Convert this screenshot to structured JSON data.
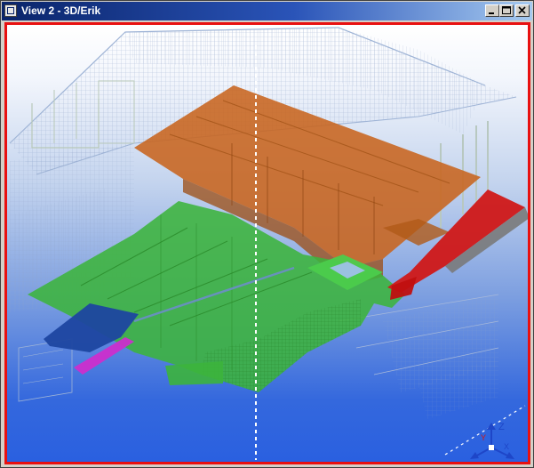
{
  "window": {
    "title": "View 2 - 3D/Erik",
    "icon": "view-icon",
    "buttons": {
      "minimize": "minimize-icon",
      "maximize": "maximize-icon",
      "close": "close-icon"
    }
  },
  "viewport": {
    "frame_color": "#e81010",
    "background_top": "#ffffff",
    "background_bottom": "#2a60e0"
  },
  "model": {
    "colors": {
      "wireframe": "#8ea2c8",
      "roof_slab": "#c8641e",
      "floor_slab": "#3cb43c",
      "blue_slab": "#1e46a0",
      "magenta_beam": "#cc2ecc",
      "red_ramp": "#d01818",
      "gray_element": "#7a7a7a"
    }
  },
  "axis_gizmo": {
    "z_label": "Z",
    "x_label": "X",
    "y_label": "Y"
  }
}
